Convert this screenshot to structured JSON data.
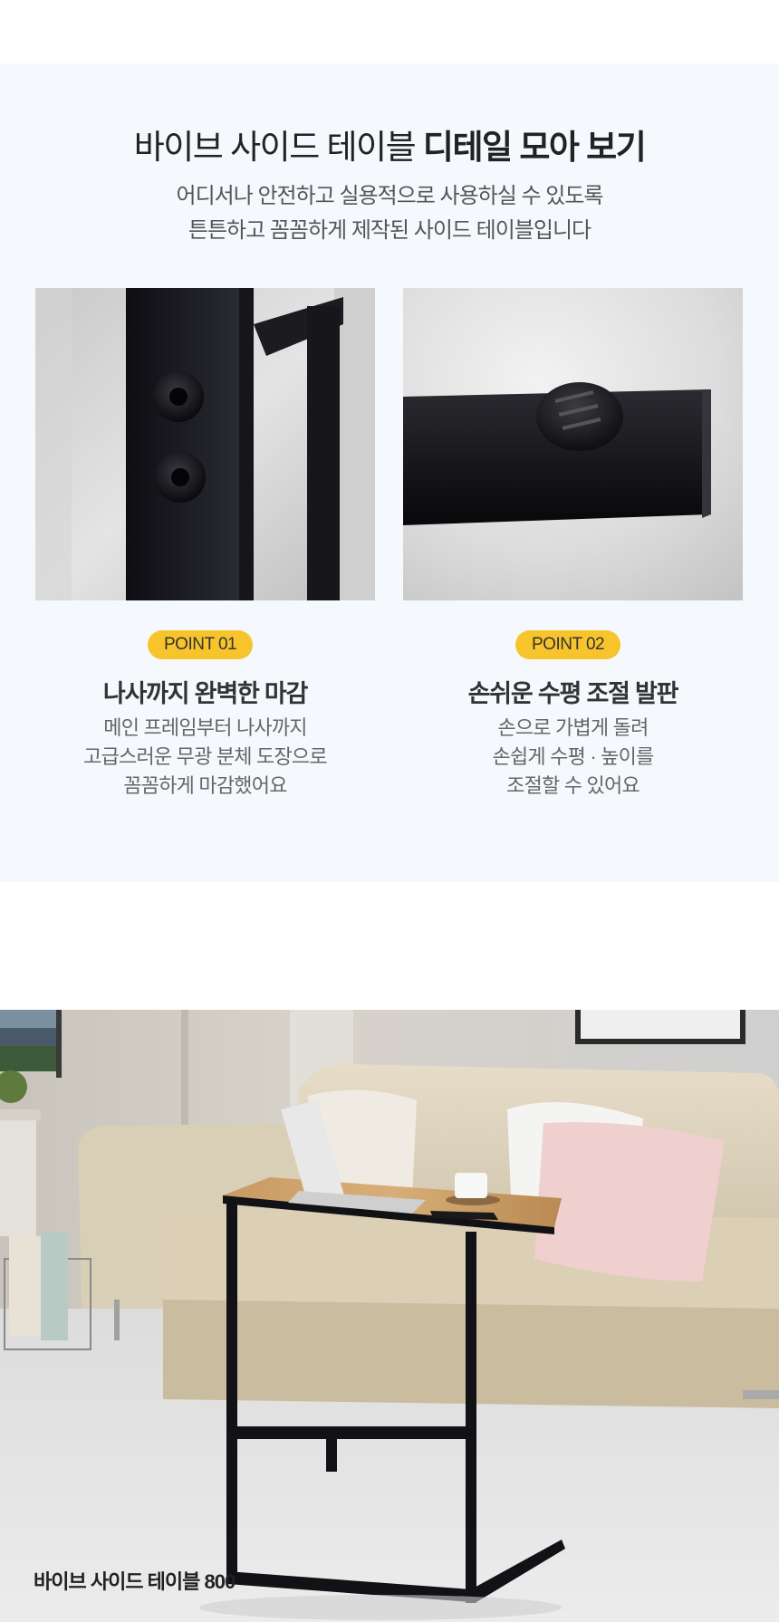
{
  "detail": {
    "headline_light": "바이브 사이드 테이블 ",
    "headline_bold": "디테일 모아 보기",
    "subtext_line1": "어디서나 안전하고 실용적으로 사용하실 수 있도록",
    "subtext_line2": "튼튼하고 꼼꼼하게 제작된 사이드 테이블입니다"
  },
  "points": [
    {
      "badge": "POINT 01",
      "title": "나사까지 완벽한 마감",
      "desc_line1": "메인 프레임부터 나사까지",
      "desc_line2": "고급스러운 무광 분체 도장으로",
      "desc_line3": "꼼꼼하게 마감했어요"
    },
    {
      "badge": "POINT 02",
      "title": "손쉬운 수평 조절 발판",
      "desc_line1": "손으로 가볍게 돌려",
      "desc_line2": "손쉽게 수평 · 높이를",
      "desc_line3": "조절할 수 있어요"
    }
  ],
  "room": {
    "caption": "바이브 사이드 테이블 800"
  },
  "colors": {
    "section_bg": "#f5f9fd",
    "badge": "#f8c42c",
    "frame_black": "#1a1a1f"
  }
}
